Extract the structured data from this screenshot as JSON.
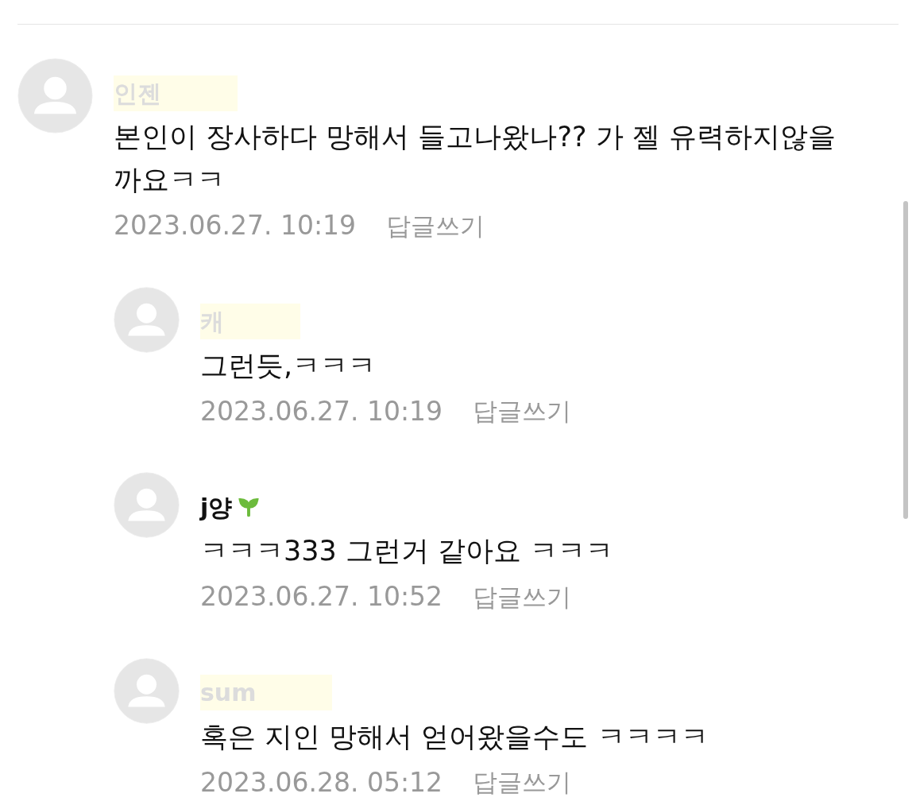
{
  "comments": [
    {
      "author": "인젠",
      "obscured": true,
      "badge": false,
      "text": "본인이 장사하다 망해서 들고나왔나?? 가 젤 유력하지않을까요ㅋㅋ",
      "date": "2023.06.27. 10:19",
      "reply_label": "답글쓰기",
      "children": [
        {
          "author": "캐",
          "obscured": true,
          "badge": false,
          "text": "그런듯,ㅋㅋㅋ",
          "date": "2023.06.27. 10:19",
          "reply_label": "답글쓰기"
        },
        {
          "author": "j양",
          "obscured": false,
          "badge": true,
          "text": "ㅋㅋㅋ333 그런거 같아요 ㅋㅋㅋ",
          "date": "2023.06.27. 10:52",
          "reply_label": "답글쓰기"
        },
        {
          "author": "sum",
          "obscured": true,
          "badge": false,
          "text": "혹은 지인 망해서 얻어왔을수도 ㅋㅋㅋㅋ",
          "date": "2023.06.28. 05:12",
          "reply_label": "답글쓰기"
        }
      ]
    }
  ]
}
